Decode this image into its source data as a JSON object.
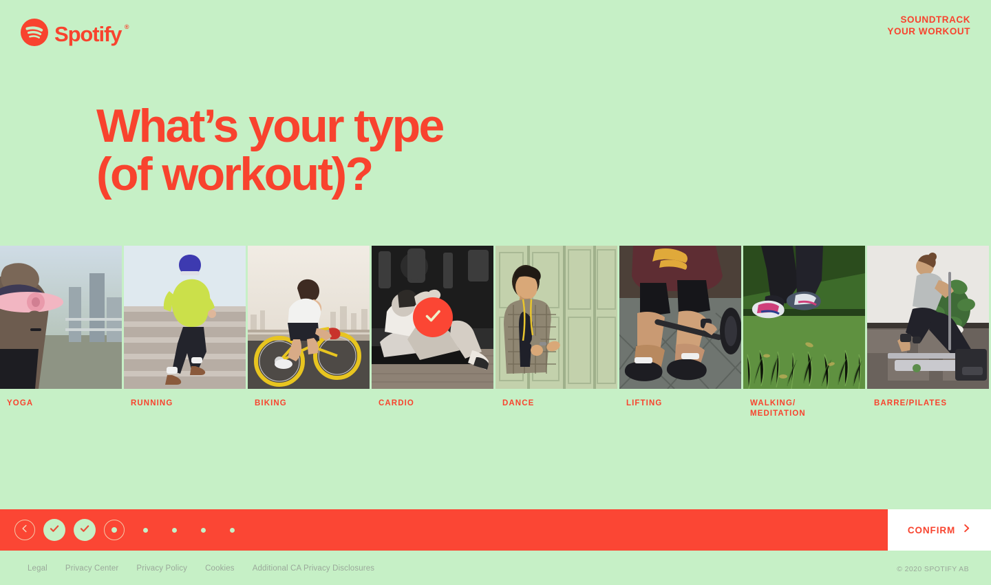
{
  "brand": {
    "logo_icon": "spotify-logo-icon",
    "logo_word": "Spotify",
    "registered_mark": "®",
    "accent_red": "#f8432e",
    "bar_red": "#fb4634",
    "background_green": "#c6f0c6"
  },
  "header": {
    "tagline_line1": "SOUNDTRACK",
    "tagline_line2": "YOUR WORKOUT"
  },
  "main": {
    "headline": "What’s your type\n(of workout)?"
  },
  "cards": [
    {
      "label": "YOGA",
      "selected": false,
      "photo": "woman-carrying-pink-yoga-mat-city"
    },
    {
      "label": "RUNNING",
      "selected": false,
      "photo": "runner-yellow-jacket-stairs"
    },
    {
      "label": "BIKING",
      "selected": false,
      "photo": "cyclist-yellow-bike-skyline"
    },
    {
      "label": "CARDIO",
      "selected": true,
      "photo": "woman-crunches-bw-gym"
    },
    {
      "label": "DANCE",
      "selected": false,
      "photo": "man-plaid-shirt-dancing-green-door"
    },
    {
      "label": "LIFTING",
      "selected": false,
      "photo": "legs-barbell-deadlift"
    },
    {
      "label": "WALKING/\nMEDITATION",
      "selected": false,
      "photo": "walking-shoes-on-grass"
    },
    {
      "label": "BARRE/PILATES",
      "selected": false,
      "photo": "woman-pilates-reformer-plant"
    }
  ],
  "progress": {
    "back_label": "Back",
    "back_icon": "chevron-left-icon",
    "steps": [
      {
        "state": "done",
        "icon": "check-icon"
      },
      {
        "state": "done",
        "icon": "check-icon"
      },
      {
        "state": "current",
        "icon": "dot-icon"
      },
      {
        "state": "upcoming",
        "icon": "dot-icon"
      },
      {
        "state": "upcoming",
        "icon": "dot-icon"
      },
      {
        "state": "upcoming",
        "icon": "dot-icon"
      },
      {
        "state": "upcoming",
        "icon": "dot-icon"
      }
    ]
  },
  "confirm": {
    "label": "CONFIRM",
    "icon": "chevron-right-icon"
  },
  "footer": {
    "links": [
      "Legal",
      "Privacy Center",
      "Privacy Policy",
      "Cookies",
      "Additional CA Privacy Disclosures"
    ],
    "copyright": "© 2020 SPOTIFY AB"
  }
}
